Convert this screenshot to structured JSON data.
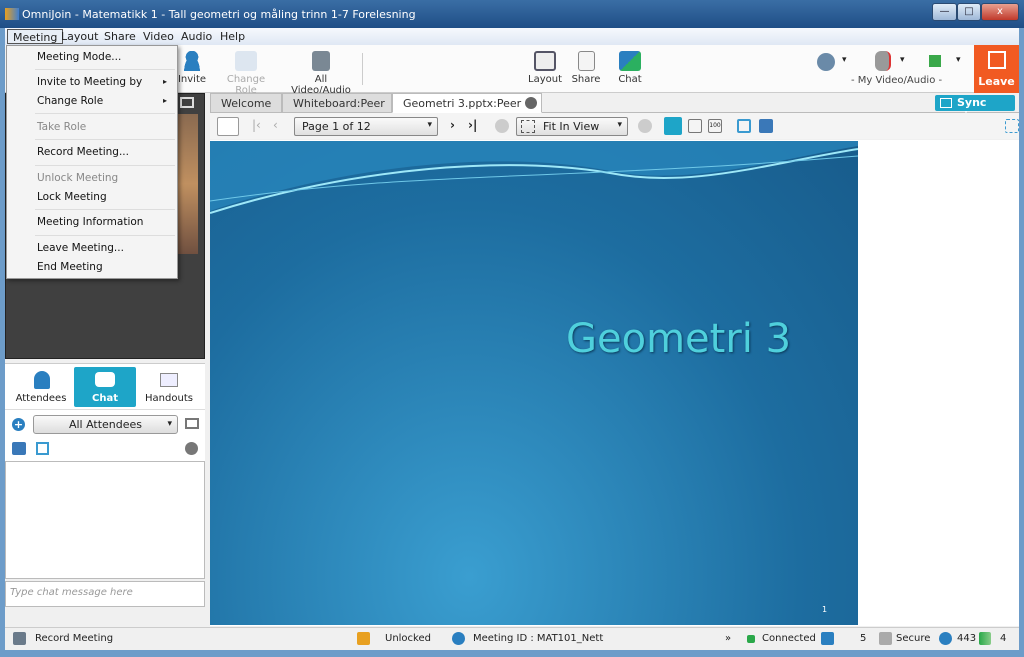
{
  "window": {
    "title": "OmniJoin - Matematikk 1 - Tall  geometri og måling  trinn 1-7  Forelesning",
    "minimize": "—",
    "maximize": "□",
    "close": "x"
  },
  "menubar": [
    "Meeting",
    "Layout",
    "Share",
    "Video",
    "Audio",
    "Help"
  ],
  "meeting_menu": {
    "items": [
      {
        "label": "Meeting Mode...",
        "enabled": true
      },
      {
        "label": "Invite to Meeting by",
        "enabled": true,
        "submenu": true
      },
      {
        "label": "Change Role",
        "enabled": true,
        "submenu": true
      },
      {
        "label": "Take Role",
        "enabled": false
      },
      {
        "label": "Record Meeting...",
        "enabled": true
      },
      {
        "label": "Unlock Meeting",
        "enabled": false
      },
      {
        "label": "Lock Meeting",
        "enabled": true
      },
      {
        "label": "Meeting Information",
        "enabled": true
      },
      {
        "label": "Leave Meeting...",
        "enabled": true
      },
      {
        "label": "End Meeting",
        "enabled": true
      }
    ],
    "submenu_arrow": "▸"
  },
  "toolbar": {
    "invite": "Invite",
    "change_role": "Change Role",
    "all_video_audio": "All Video/Audio",
    "layout": "Layout",
    "share": "Share",
    "chat": "Chat",
    "my_video_audio": "- My Video/Audio -",
    "leave": "Leave",
    "dropdown_arrow": "▾"
  },
  "panel": {
    "tabs": [
      "Attendees",
      "Chat",
      "Handouts"
    ],
    "active_tab": "Chat",
    "recipient": "All Attendees",
    "chat_placeholder": "Type chat message here"
  },
  "doc_tabs": {
    "tabs": [
      "Welcome",
      "Whiteboard:Peer",
      "Geometri 3.pptx:Peer"
    ],
    "active": "Geometri 3.pptx:Peer",
    "sync_view": "Sync view"
  },
  "doc_toolbar": {
    "page": "Page 1 of 12",
    "zoom": "Fit In View",
    "zoom_100": "100"
  },
  "slide": {
    "title": "Geometri 3",
    "number": "1"
  },
  "status": {
    "record": "Record Meeting",
    "lock": "Unlocked",
    "meeting_id": "Meeting ID : MAT101_Nett",
    "more": "»",
    "connection": "Connected",
    "signal1": "5",
    "security": "Secure",
    "port": "443",
    "signal2": "4"
  },
  "colors": {
    "accent": "#1ea5c8",
    "leave": "#f15a22",
    "connected": "#2aa84a"
  }
}
